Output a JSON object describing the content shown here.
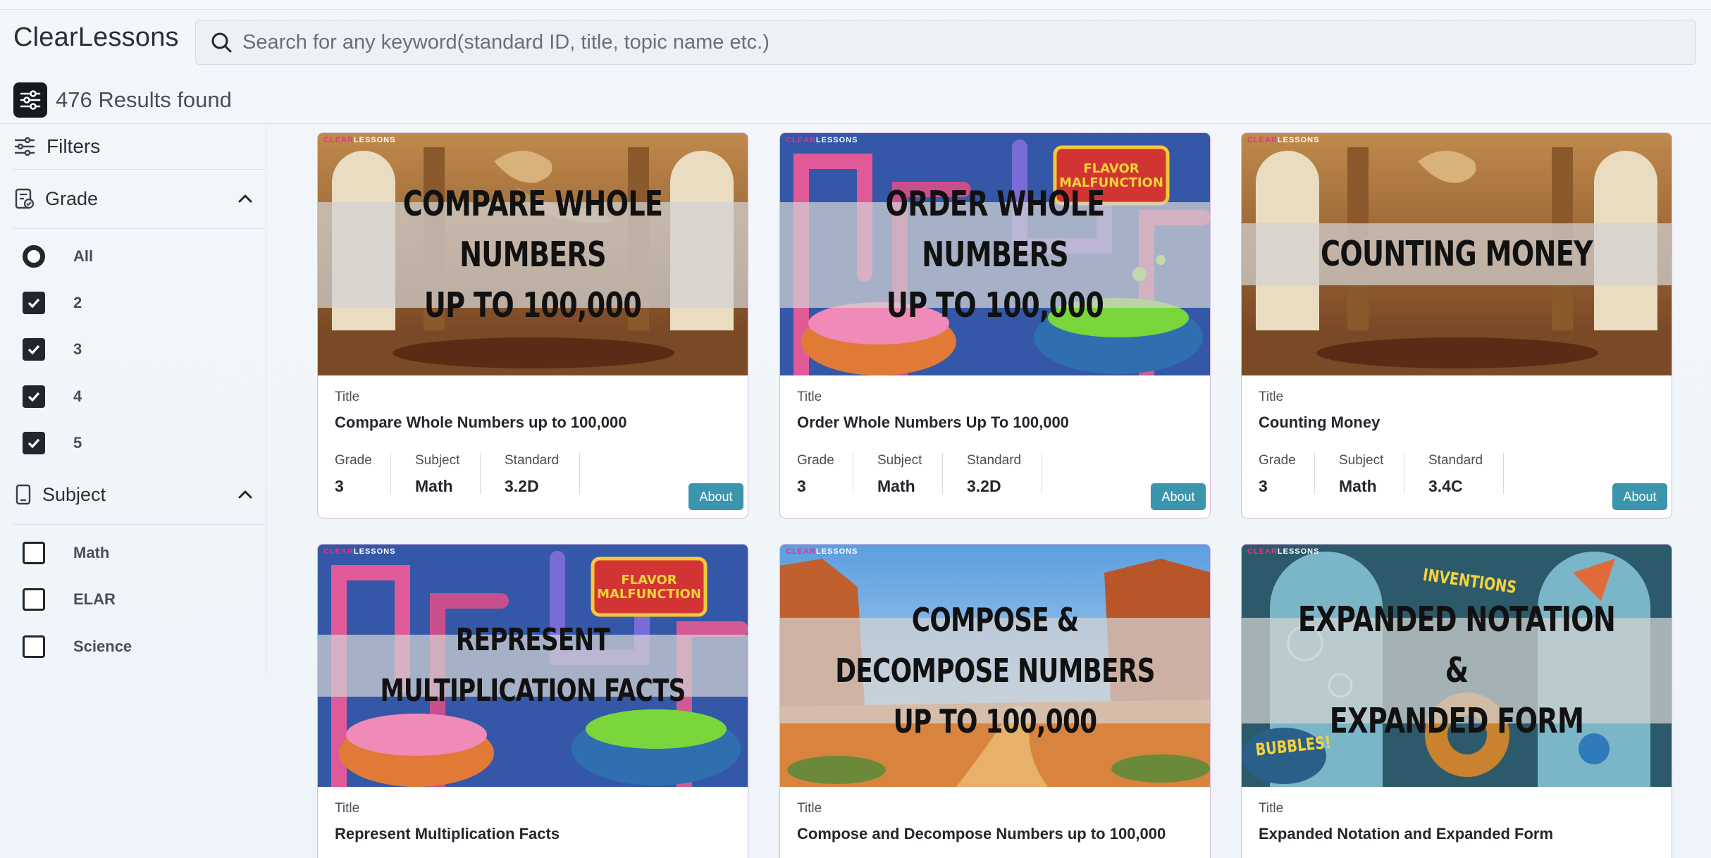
{
  "app": {
    "name": "ClearLessons"
  },
  "search": {
    "placeholder": "Search for any keyword(standard ID, title, topic name etc.)"
  },
  "results": {
    "count_text": "476 Results found"
  },
  "sidebar": {
    "filters_label": "Filters",
    "grade": {
      "label": "Grade",
      "options": [
        {
          "label": "All",
          "kind": "radio",
          "checked": false
        },
        {
          "label": "2",
          "kind": "checkbox",
          "checked": true
        },
        {
          "label": "3",
          "kind": "checkbox",
          "checked": true
        },
        {
          "label": "4",
          "kind": "checkbox",
          "checked": true
        },
        {
          "label": "5",
          "kind": "checkbox",
          "checked": true
        }
      ]
    },
    "subject": {
      "label": "Subject",
      "options": [
        {
          "label": "Math",
          "kind": "checkbox",
          "checked": false
        },
        {
          "label": "ELAR",
          "kind": "checkbox",
          "checked": false
        },
        {
          "label": "Science",
          "kind": "checkbox",
          "checked": false
        }
      ]
    }
  },
  "card_labels": {
    "title": "Title",
    "grade": "Grade",
    "subject": "Subject",
    "standard": "Standard",
    "about": "About"
  },
  "thumb_brand": {
    "a": "CLEAR",
    "b": "LESSONS"
  },
  "cards": [
    {
      "thumb_text": "COMPARE WHOLE NUMBERS\nUP TO 100,000",
      "title": "Compare Whole Numbers up to 100,000",
      "grade": "3",
      "subject": "Math",
      "standard": "3.2D",
      "theme": "museum"
    },
    {
      "thumb_text": "ORDER WHOLE NUMBERS\nUP TO 100,000",
      "title": "Order Whole Numbers Up To 100,000",
      "grade": "3",
      "subject": "Math",
      "standard": "3.2D",
      "theme": "factory"
    },
    {
      "thumb_text": "COUNTING MONEY",
      "title": "Counting Money",
      "grade": "3",
      "subject": "Math",
      "standard": "3.4C",
      "theme": "museum"
    },
    {
      "thumb_text": "REPRESENT MULTIPLICATION FACTS",
      "title": "Represent Multiplication Facts",
      "theme": "factory"
    },
    {
      "thumb_text": "COMPOSE & DECOMPOSE NUMBERS\nUP TO 100,000",
      "title": "Compose and Decompose Numbers up to 100,000",
      "theme": "canyon"
    },
    {
      "thumb_text": "EXPANDED NOTATION &\nEXPANDED FORM",
      "title": "Expanded Notation and Expanded Form",
      "theme": "lab"
    }
  ],
  "thumb_signs": {
    "flavor": "FLAVOR\nMALFUNCTION",
    "inventions": "INVENTIONS",
    "bubbles": "BUBBLES!"
  }
}
